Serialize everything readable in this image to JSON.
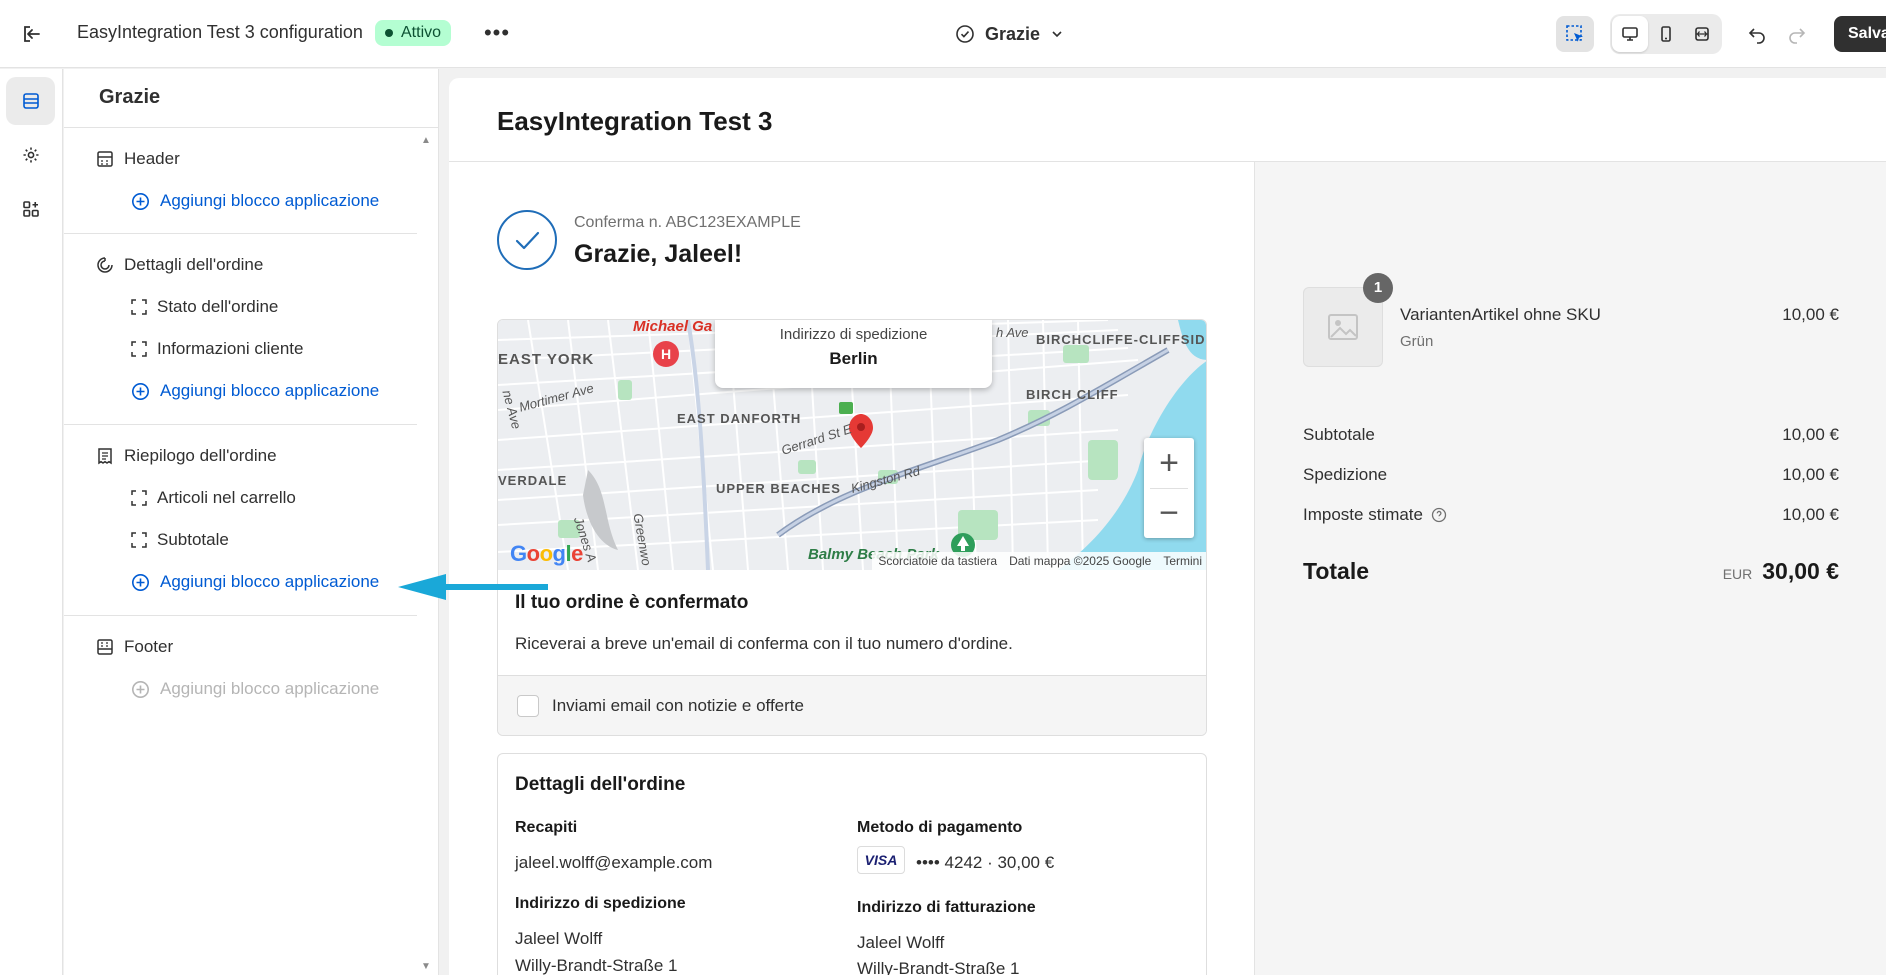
{
  "topbar": {
    "title": "EasyIntegration Test 3 configuration",
    "status_badge": "Attivo",
    "more": "•••",
    "page_selector": "Grazie",
    "save_label": "Salva"
  },
  "panel": {
    "title": "Grazie",
    "sections": [
      {
        "label": "Header",
        "icon": "layout-header-icon",
        "blocks": [],
        "add_label": "Aggiungi blocco applicazione",
        "add_enabled": true
      },
      {
        "label": "Dettagli dell'ordine",
        "icon": "order-details-icon",
        "blocks": [
          "Stato dell'ordine",
          "Informazioni cliente"
        ],
        "add_label": "Aggiungi blocco applicazione",
        "add_enabled": true
      },
      {
        "label": "Riepilogo dell'ordine",
        "icon": "receipt-icon",
        "blocks": [
          "Articoli nel carrello",
          "Subtotale"
        ],
        "add_label": "Aggiungi blocco applicazione",
        "add_enabled": true
      },
      {
        "label": "Footer",
        "icon": "layout-footer-icon",
        "blocks": [],
        "add_label": "Aggiungi blocco applicazione",
        "add_enabled": false
      }
    ]
  },
  "preview": {
    "shop_name": "EasyIntegration Test 3",
    "confirmation_number": "Conferma n. ABC123EXAMPLE",
    "thanks": "Grazie, Jaleel!",
    "map": {
      "tooltip_label": "Indirizzo di spedizione",
      "tooltip_city": "Berlin",
      "labels": {
        "michael": "Michael Ga",
        "east_york": "EAST YORK",
        "mortimer": "Mortimer Ave",
        "east_danforth": "EAST DANFORTH",
        "gerrard": "Gerrard St E",
        "upper_beaches": "UPPER BEACHES",
        "kingston": "Kingston Rd",
        "birchcliffe": "BIRCHCLIFFE-CLIFFSID",
        "birch_cliff": "BIRCH CLIFF",
        "verdale": "VERDALE",
        "balmy": "Balmy Beach Park",
        "jones": "Jones A",
        "greenwo": "Greenwo",
        "ne_ave": "Ave",
        "sh_ave": "ne Ave",
        "ih_ave": "h Ave"
      },
      "google": "Google",
      "attribution": [
        "Scorciatoie da tastiera",
        "Dati mappa ©2025 Google",
        "Termini"
      ]
    },
    "confirmed_title": "Il tuo ordine è confermato",
    "confirmed_text": "Riceverai a breve un'email di conferma con il tuo numero d'ordine.",
    "newsletter": "Inviami email con notizie e offerte",
    "details": {
      "title": "Dettagli dell'ordine",
      "contact_heading": "Recapiti",
      "contact_email": "jaleel.wolff@example.com",
      "payment_heading": "Metodo di pagamento",
      "card_brand": "VISA",
      "payment_value": "•••• 4242 · 30,00 €",
      "shipping_heading": "Indirizzo di spedizione",
      "shipping_lines": [
        "Jaleel Wolff",
        "Willy-Brandt-Straße 1"
      ],
      "billing_heading": "Indirizzo di fatturazione",
      "billing_lines": [
        "Jaleel Wolff",
        "Willy-Brandt-Straße 1"
      ]
    }
  },
  "summary": {
    "item": {
      "quantity": "1",
      "name": "VariantenArtikel ohne SKU",
      "variant": "Grün",
      "price": "10,00 €"
    },
    "subtotal_label": "Subtotale",
    "subtotal_value": "10,00 €",
    "shipping_label": "Spedizione",
    "shipping_value": "10,00 €",
    "taxes_label": "Imposte stimate",
    "taxes_value": "10,00 €",
    "total_label": "Totale",
    "currency": "EUR",
    "total_value": "30,00 €"
  },
  "colors": {
    "accent": "#005bd3",
    "arrow": "#1aa8d8",
    "badge_bg": "#b4fed2",
    "badge_text": "#0c5132",
    "check": "#1f6db8"
  }
}
